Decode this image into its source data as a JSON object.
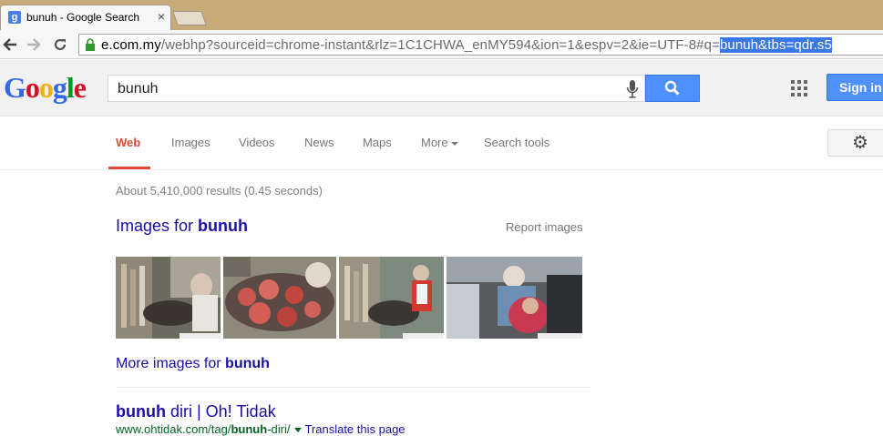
{
  "browser": {
    "tab_title": "bunuh - Google Search",
    "tab_favicon": "g",
    "close_glyph": "×",
    "url_prefix": "e.",
    "url_host": "com.my",
    "url_path": "/webhp?sourceid=chrome-instant&rlz=1C1CHWA_enMY594&ion=1&espv=2&ie=UTF-8#q=",
    "url_selected": "bunuh&tbs=qdr.s5"
  },
  "google": {
    "logo_letters": [
      "G",
      "o",
      "o",
      "g",
      "l",
      "e"
    ],
    "logo_colors": [
      "#3369e8",
      "#d50f25",
      "#eeb211",
      "#3369e8",
      "#009925",
      "#d50f25"
    ],
    "query": "bunuh",
    "signin_label": "Sign in"
  },
  "nav": {
    "tabs": [
      {
        "label": "Web",
        "active": true
      },
      {
        "label": "Images"
      },
      {
        "label": "Videos"
      },
      {
        "label": "News"
      },
      {
        "label": "Maps"
      },
      {
        "label": "More"
      },
      {
        "label": "Search tools"
      }
    ]
  },
  "results": {
    "stats": "About 5,410,000 results (0.45 seconds)",
    "images_prefix": "Images for ",
    "images_query": "bunuh",
    "report_images": "Report images",
    "more_images_prefix": "More images for ",
    "more_images_query": "bunuh",
    "first": {
      "title_bold": "bunuh",
      "title_rest": " diri | Oh! Tidak",
      "url_prefix": "www.ohtidak.com/tag/",
      "url_bold": "bunuh",
      "url_suffix": "-diri/",
      "translate": "Translate this page"
    }
  },
  "colors": {
    "accent_red": "#dd4b39",
    "link_blue": "#1a0dab",
    "url_green": "#006621",
    "button_blue": "#4d90fe"
  }
}
